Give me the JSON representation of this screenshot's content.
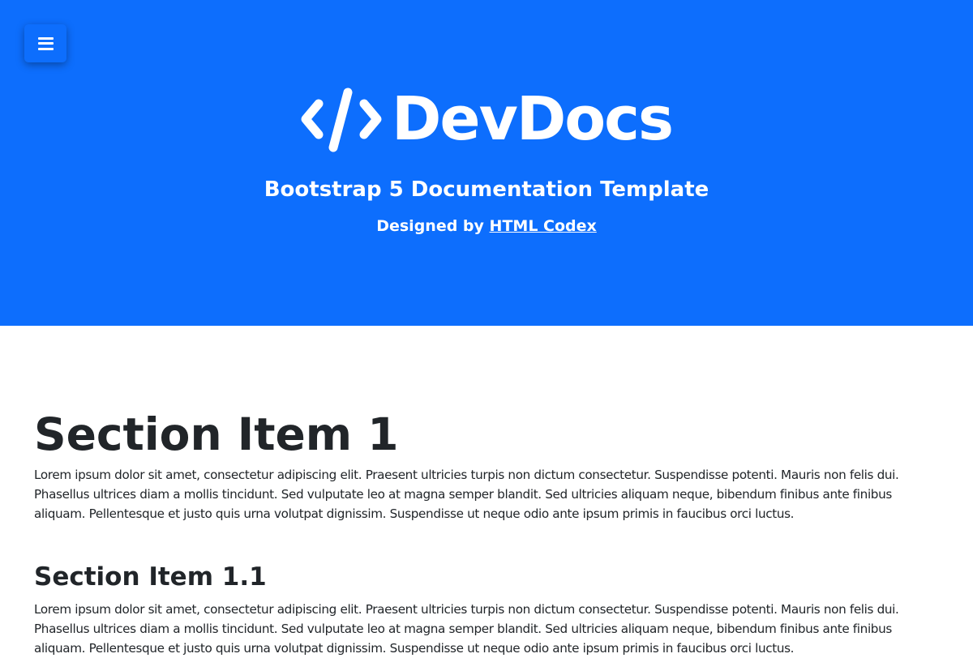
{
  "header": {
    "brand_name": "DevDocs",
    "tagline": "Bootstrap 5 Documentation Template",
    "credit_prefix": "Designed by",
    "credit_link": "HTML Codex",
    "brand_color": "#0d6efd",
    "menu_icon": "hamburger-menu-icon",
    "logo_icon": "code-slash-icon"
  },
  "sections": [
    {
      "title": "Section Item 1",
      "body": "Lorem ipsum dolor sit amet, consectetur adipiscing elit. Praesent ultricies turpis non dictum consectetur. Suspendisse potenti. Mauris non felis dui. Phasellus ultrices diam a mollis tincidunt. Sed vulputate leo at magna semper blandit. Sed ultricies aliquam neque, bibendum finibus ante finibus aliquam. Pellentesque et justo quis urna volutpat dignissim. Suspendisse ut neque odio ante ipsum primis in faucibus orci luctus."
    },
    {
      "title": "Section Item 1.1",
      "body": "Lorem ipsum dolor sit amet, consectetur adipiscing elit. Praesent ultricies turpis non dictum consectetur. Suspendisse potenti. Mauris non felis dui. Phasellus ultrices diam a mollis tincidunt. Sed vulputate leo at magna semper blandit. Sed ultricies aliquam neque, bibendum finibus ante finibus aliquam. Pellentesque et justo quis urna volutpat dignissim. Suspendisse ut neque odio ante ipsum primis in faucibus orci luctus."
    }
  ]
}
